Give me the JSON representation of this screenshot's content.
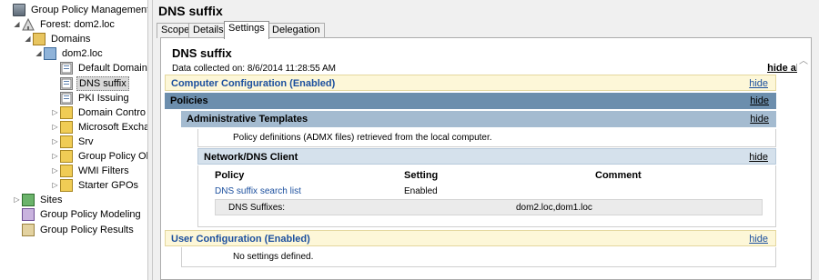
{
  "tree": {
    "items": [
      {
        "label": "Group Policy Management",
        "icon": "gpm-icon",
        "depth": 0,
        "expander": ""
      },
      {
        "label": "Forest: dom2.loc",
        "icon": "forest-icon",
        "depth": 1,
        "expander": "◢"
      },
      {
        "label": "Domains",
        "icon": "domains-icon",
        "depth": 2,
        "expander": "◢"
      },
      {
        "label": "dom2.loc",
        "icon": "domain-icon",
        "depth": 3,
        "expander": "◢"
      },
      {
        "label": "Default Domain",
        "icon": "gpo-link-icon",
        "depth": 4,
        "expander": ""
      },
      {
        "label": "DNS suffix",
        "icon": "gpo-link-icon",
        "depth": 4,
        "expander": "",
        "selected": true
      },
      {
        "label": "PKI Issuing",
        "icon": "gpo-link-icon",
        "depth": 4,
        "expander": ""
      },
      {
        "label": "Domain Contro",
        "icon": "ou-icon",
        "depth": 4,
        "expander": "▷"
      },
      {
        "label": "Microsoft Excha",
        "icon": "ou-icon",
        "depth": 4,
        "expander": "▷"
      },
      {
        "label": "Srv",
        "icon": "ou-icon",
        "depth": 4,
        "expander": "▷"
      },
      {
        "label": "Group Policy Ob",
        "icon": "gpo-container-icon",
        "depth": 4,
        "expander": "▷"
      },
      {
        "label": "WMI Filters",
        "icon": "wmi-filters-icon",
        "depth": 4,
        "expander": "▷"
      },
      {
        "label": "Starter GPOs",
        "icon": "starter-gpos-icon",
        "depth": 4,
        "expander": "▷"
      },
      {
        "label": "Sites",
        "icon": "sites-icon",
        "depth": 1,
        "expander": "▷"
      },
      {
        "label": "Group Policy Modeling",
        "icon": "modeling-icon",
        "depth": 1,
        "expander": ""
      },
      {
        "label": "Group Policy Results",
        "icon": "results-icon",
        "depth": 1,
        "expander": ""
      }
    ]
  },
  "pane": {
    "title": "DNS suffix",
    "tabs": [
      "Scope",
      "Details",
      "Settings",
      "Delegation"
    ],
    "active_tab": "Settings"
  },
  "report": {
    "title": "DNS suffix",
    "collected": "Data collected on: 8/6/2014 11:28:55 AM",
    "hide_all": "hide all",
    "hide": "hide",
    "computer_config": "Computer Configuration (Enabled)",
    "policies": "Policies",
    "admin_templates": "Administrative Templates",
    "admx_note": "Policy definitions (ADMX files) retrieved from the local computer.",
    "network_dns": "Network/DNS Client",
    "columns": {
      "policy": "Policy",
      "setting": "Setting",
      "comment": "Comment"
    },
    "policy_row": {
      "policy": "DNS suffix search list",
      "setting": "Enabled"
    },
    "sub_row": {
      "label": "DNS Suffixes:",
      "value": "dom2.loc,dom1.loc"
    },
    "user_config": "User Configuration (Enabled)",
    "no_settings": "No settings defined."
  },
  "colors": {
    "config_bar": "#fdf7d8",
    "policies_bar": "#6c8ead",
    "admin_bar": "#a4bbd0",
    "link_blue": "#1b4f9e"
  }
}
